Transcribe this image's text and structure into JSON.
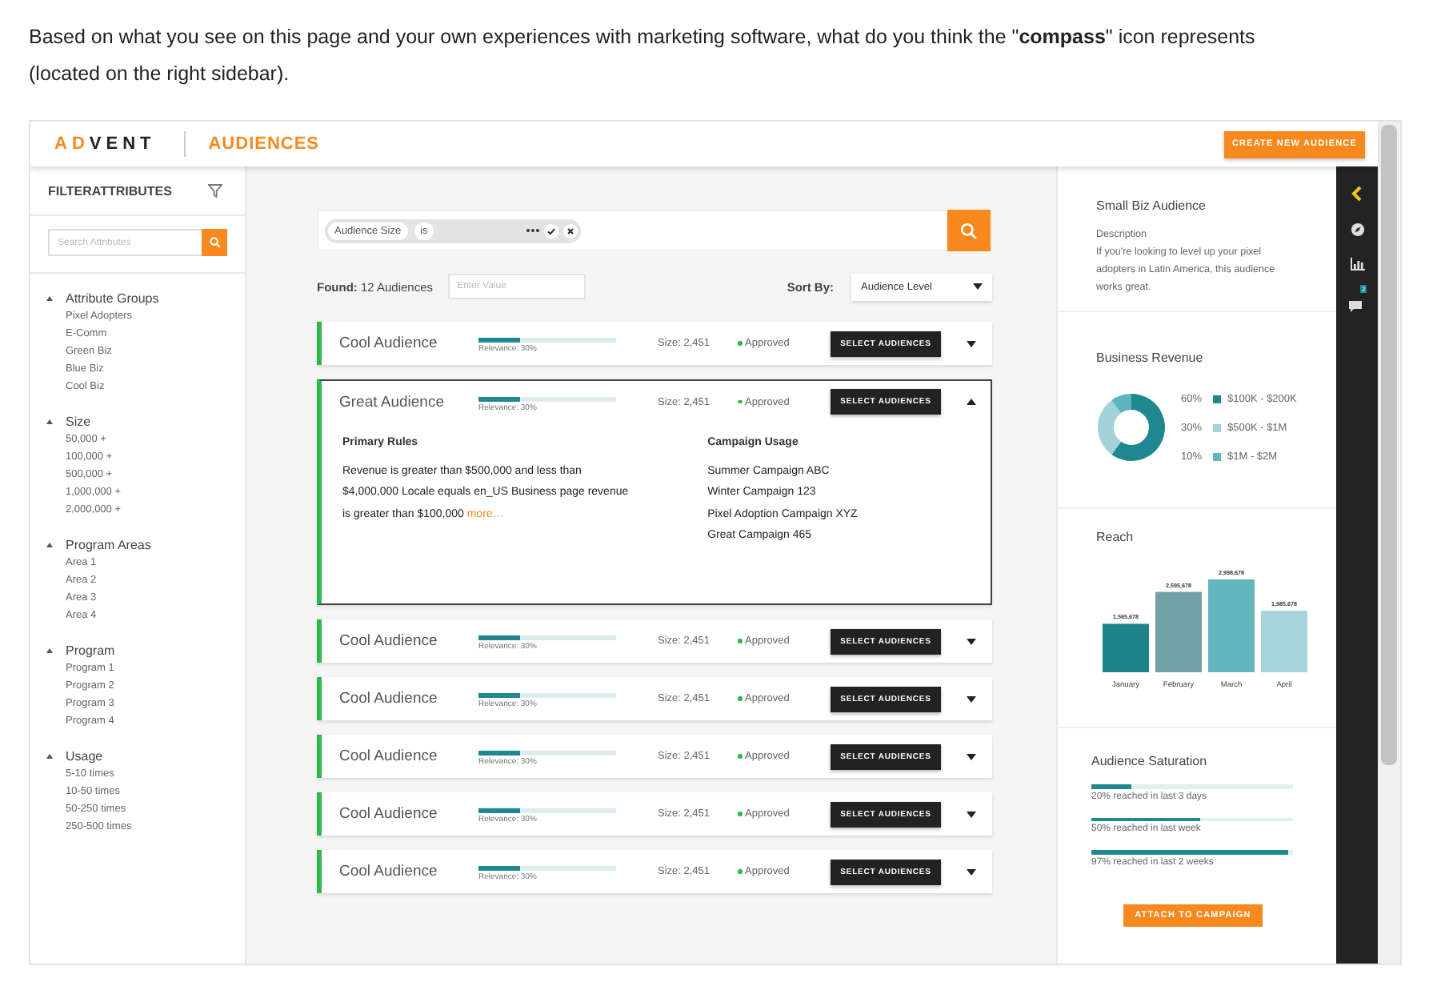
{
  "prompt": {
    "text": "Based on what you see on this page and your own experiences with marketing software, what do you think the \"**compass**\" icon represents (located on the right sidebar)."
  },
  "header": {
    "logo": {
      "accent": "AD",
      "rest": "VENT"
    },
    "section": "AUDIENCES",
    "create_button": "CREATE NEW AUDIENCE"
  },
  "filters": {
    "title": "FILTERATTRIBUTES",
    "search_placeholder": "Search Attributes",
    "groups": [
      {
        "label": "Attribute Groups",
        "expanded": true,
        "children": [
          {
            "label": "Pixel Adopters"
          },
          {
            "label": "E-Comm"
          },
          {
            "label": "Green Biz"
          },
          {
            "label": "Blue Biz"
          },
          {
            "label": "Cool Biz"
          }
        ]
      },
      {
        "label": "Size",
        "expanded": true,
        "children": [
          {
            "label": "50,000 +"
          },
          {
            "label": "100,000 +"
          },
          {
            "label": "500,000 +"
          },
          {
            "label": "1,000,000 +"
          },
          {
            "label": "2,000,000 +"
          }
        ]
      },
      {
        "label": "Program Areas",
        "expanded": true,
        "children": [
          {
            "label": "Area 1"
          },
          {
            "label": "Area 2"
          },
          {
            "label": "Area 3"
          },
          {
            "label": "Area 4"
          }
        ]
      },
      {
        "label": "Program",
        "expanded": true,
        "children": [
          {
            "label": "Program 1"
          },
          {
            "label": "Program 2"
          },
          {
            "label": "Program 3"
          },
          {
            "label": "Program 4"
          }
        ]
      },
      {
        "label": "Usage",
        "expanded": true,
        "children": [
          {
            "label": "5-10 times"
          },
          {
            "label": "10-50 times"
          },
          {
            "label": "50-250 times"
          },
          {
            "label": "250-500 times"
          }
        ]
      }
    ]
  },
  "query": {
    "chips": [
      "Audience Size",
      "is"
    ]
  },
  "results": {
    "found_label": "Found:",
    "found_count": "12 Audiences",
    "value_placeholder": "Enter Value",
    "sort_label": "Sort By:",
    "sort_value": "Audience Level"
  },
  "audiences": [
    {
      "name": "Cool Audience",
      "level": 0.3,
      "relevance": "Relevance: 30%",
      "size": "Size: 2,451",
      "status": "Approved",
      "button": "SELECT AUDIENCES",
      "expanded": false
    },
    {
      "name": "Great Audience",
      "level": 0.3,
      "relevance": "Relevance: 30%",
      "size": "Size: 2,451",
      "status": "Approved",
      "button": "SELECT AUDIENCES",
      "expanded": true,
      "details": {
        "rules_title": "Primary Rules",
        "rules": "Revenue is greater than $500,000 and less than $4,000,000 Locale equals en_US Business page revenue is greater than $100,000",
        "more": "more…",
        "usage_title": "Campaign Usage",
        "campaigns": [
          "Summer Campaign ABC",
          "Winter Campaign 123",
          "Pixel Adoption Campaign XYZ",
          "Great Campaign 465"
        ]
      }
    },
    {
      "name": "Cool Audience",
      "level": 0.3,
      "relevance": "Relevance: 30%",
      "size": "Size: 2,451",
      "status": "Approved",
      "button": "SELECT AUDIENCES",
      "expanded": false
    },
    {
      "name": "Cool Audience",
      "level": 0.3,
      "relevance": "Relevance: 30%",
      "size": "Size: 2,451",
      "status": "Approved",
      "button": "SELECT AUDIENCES",
      "expanded": false
    },
    {
      "name": "Cool Audience",
      "level": 0.3,
      "relevance": "Relevance: 30%",
      "size": "Size: 2,451",
      "status": "Approved",
      "button": "SELECT AUDIENCES",
      "expanded": false
    },
    {
      "name": "Cool Audience",
      "level": 0.3,
      "relevance": "Relevance: 30%",
      "size": "Size: 2,451",
      "status": "Approved",
      "button": "SELECT AUDIENCES",
      "expanded": false
    },
    {
      "name": "Cool Audience",
      "level": 0.3,
      "relevance": "Relevance: 30%",
      "size": "Size: 2,451",
      "status": "Approved",
      "button": "SELECT AUDIENCES",
      "expanded": false
    }
  ],
  "summary": {
    "title": "Small Biz Audience",
    "description_label": "Description",
    "description": "If you're looking to level up your pixel adopters in Latin America, this audience works great."
  },
  "business_revenue": {
    "title": "Business Revenue",
    "legend": [
      {
        "percent": "60%",
        "color": "#1f8790"
      },
      {
        "percent": "30%",
        "color": "#a3d3d8"
      },
      {
        "percent": "10%",
        "color": "#5cb4bc"
      }
    ],
    "chart_data": {
      "type": "donut",
      "categories": [
        "$100K - $200K",
        "$500K - $1M",
        "$1M - $2M"
      ],
      "values": [
        60,
        30,
        10
      ]
    }
  },
  "reach": {
    "title": "Reach",
    "chart_data": {
      "type": "bar",
      "categories": [
        "January",
        "February",
        "March",
        "April"
      ],
      "values": [
        1565678,
        2595678,
        2998678,
        1985678
      ],
      "value_labels": [
        "1,565,678",
        "2,595,678",
        "2,998,678",
        "1,985,678"
      ],
      "colors": [
        "#1f838c",
        "#6fa1a5",
        "#63b6bd",
        "#a6d4d9"
      ]
    }
  },
  "saturation": {
    "title": "Audience Saturation",
    "bars": [
      {
        "label": "20% reached in last 3 days",
        "level": 0.2
      },
      {
        "label": "50% reached in last week",
        "level": 0.54
      },
      {
        "label": "97% reached in last 2 weeks",
        "level": 0.98
      }
    ],
    "button": "ATTACH TO CAMPAIGN"
  },
  "rail": {
    "chat_badge": "2"
  }
}
